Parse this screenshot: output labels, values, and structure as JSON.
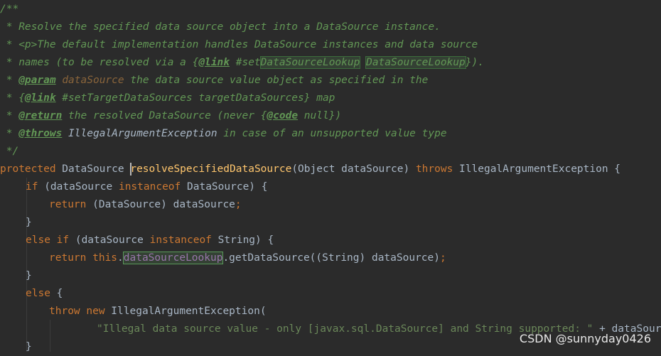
{
  "code": {
    "l1": "/**",
    "l2": " * Resolve the specified data source object into a DataSource instance.",
    "l3_a": " * ",
    "l3_b": "<p>",
    "l3_c": "The default implementation handles DataSource instances and data source",
    "l4_a": " * names (to be resolved via a ",
    "l4_b": "{",
    "l4_tag": "@link",
    "l4_c": " #set",
    "l4_d": "DataSourceLookup",
    "l4_e": " ",
    "l4_f": "DataSourceLookup",
    "l4_g": "}).",
    "l5_a": " * ",
    "l5_tag": "@param",
    "l5_p": " dataSource",
    "l5_c": " the data source value object as specified in the",
    "l6_a": " * {",
    "l6_tag": "@link",
    "l6_c": " #setTargetDataSources targetDataSources} map",
    "l7_a": " * ",
    "l7_tag": "@return",
    "l7_c": " the resolved DataSource (never {",
    "l7_tag2": "@code",
    "l7_d": " null})",
    "l8_a": " * ",
    "l8_tag": "@throws",
    "l8_e": " IllegalArgumentException",
    "l8_c": " in case of an unsupported value type",
    "l9": " */",
    "l10_kw": "protected",
    "l10_t": " DataSource ",
    "l10_fn": "resolveSpecifiedDataSource",
    "l10_a": "(Object dataSource) ",
    "l10_kw2": "throws",
    "l10_b": " IllegalArgumentException {",
    "l11_kw": "if",
    "l11_a": " (dataSource ",
    "l11_kw2": "instanceof",
    "l11_b": " DataSource) {",
    "l12_kw": "return",
    "l12_a": " (DataSource) dataSource",
    "l12_semi": ";",
    "l13": "}",
    "l14_kw": "else if",
    "l14_a": " (dataSource ",
    "l14_kw2": "instanceof",
    "l14_b": " String) {",
    "l15_kw": "return this",
    "l15_dot": ".",
    "l15_field": "dataSourceLookup",
    "l15_a": ".getDataSource((String) dataSource)",
    "l15_semi": ";",
    "l16": "}",
    "l17_kw": "else",
    "l17_a": " {",
    "l18_kw": "throw new",
    "l18_a": " IllegalArgumentException(",
    "l19_str": "\"Illegal data source value - only [javax.sql.DataSource] and String supported: \"",
    "l19_a": " + dataSource)",
    "l19_semi": ";",
    "l20": "}"
  },
  "watermark": "CSDN @sunnyday0426"
}
